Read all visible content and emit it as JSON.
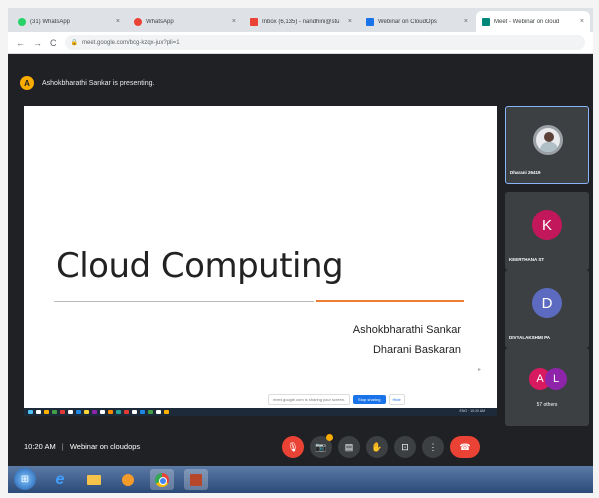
{
  "browser": {
    "tabs": [
      {
        "label": "(31) WhatsApp",
        "icon": "whatsapp-icon",
        "color": "#25d366"
      },
      {
        "label": "WhatsApp",
        "icon": "whatsapp-icon",
        "color": "#ea4335"
      },
      {
        "label": "Inbox (6,135) - nandhini@stu",
        "icon": "gmail-icon",
        "color": "#ea4335"
      },
      {
        "label": "Webinar on CloudOps",
        "icon": "calendar-icon",
        "color": "#1a73e8"
      },
      {
        "label": "Meet - Webinar on cloud",
        "icon": "meet-icon",
        "color": "#00897b"
      }
    ],
    "close_glyph": "×",
    "url": "meet.google.com/bcg-kzqx-jux?pli=1",
    "nav": {
      "back": "←",
      "forward": "→",
      "reload": "C"
    }
  },
  "presenting_banner": "Ashokbharathi Sankar is presenting.",
  "presenter_initial": "A",
  "slide": {
    "title": "Cloud Computing",
    "author1": "Ashokbharathi Sankar",
    "author2": "Dharani Baskaran",
    "share_notice": "meet.google.com is sharing your screen.",
    "stop_label": "Stop sharing",
    "hide_label": "Hide",
    "tray_text": "ENG · 10:20 AM"
  },
  "participants": [
    {
      "name": "Dharani 26419",
      "initial": "",
      "color": "#e8eaed",
      "photo": true
    },
    {
      "name": "KEERTHANA ST",
      "initial": "K",
      "color": "#c2185b"
    },
    {
      "name": "DIVYALAKSHMI PA",
      "initial": "D",
      "color": "#5c6bc0"
    }
  ],
  "others": {
    "label": "57 others",
    "avatars": [
      {
        "initial": "A",
        "color": "#d81b60"
      },
      {
        "initial": "L",
        "color": "#8e24aa"
      }
    ]
  },
  "meeting": {
    "time": "10:20 AM",
    "separator": "|",
    "name": "Webinar on cloudops"
  },
  "controls": [
    {
      "name": "mic-off-icon",
      "glyph": "🎙",
      "red": true
    },
    {
      "name": "camera-icon",
      "glyph": "📷",
      "red": false
    },
    {
      "name": "captions-icon",
      "glyph": "▤",
      "red": false
    },
    {
      "name": "raise-hand-icon",
      "glyph": "✋",
      "red": false
    },
    {
      "name": "present-icon",
      "glyph": "⊡",
      "red": false
    },
    {
      "name": "more-options-icon",
      "glyph": "⋮",
      "red": false
    },
    {
      "name": "hang-up-icon",
      "glyph": "☎",
      "red": true
    }
  ],
  "taskbar": {
    "ie": "e",
    "start": "⊞"
  }
}
